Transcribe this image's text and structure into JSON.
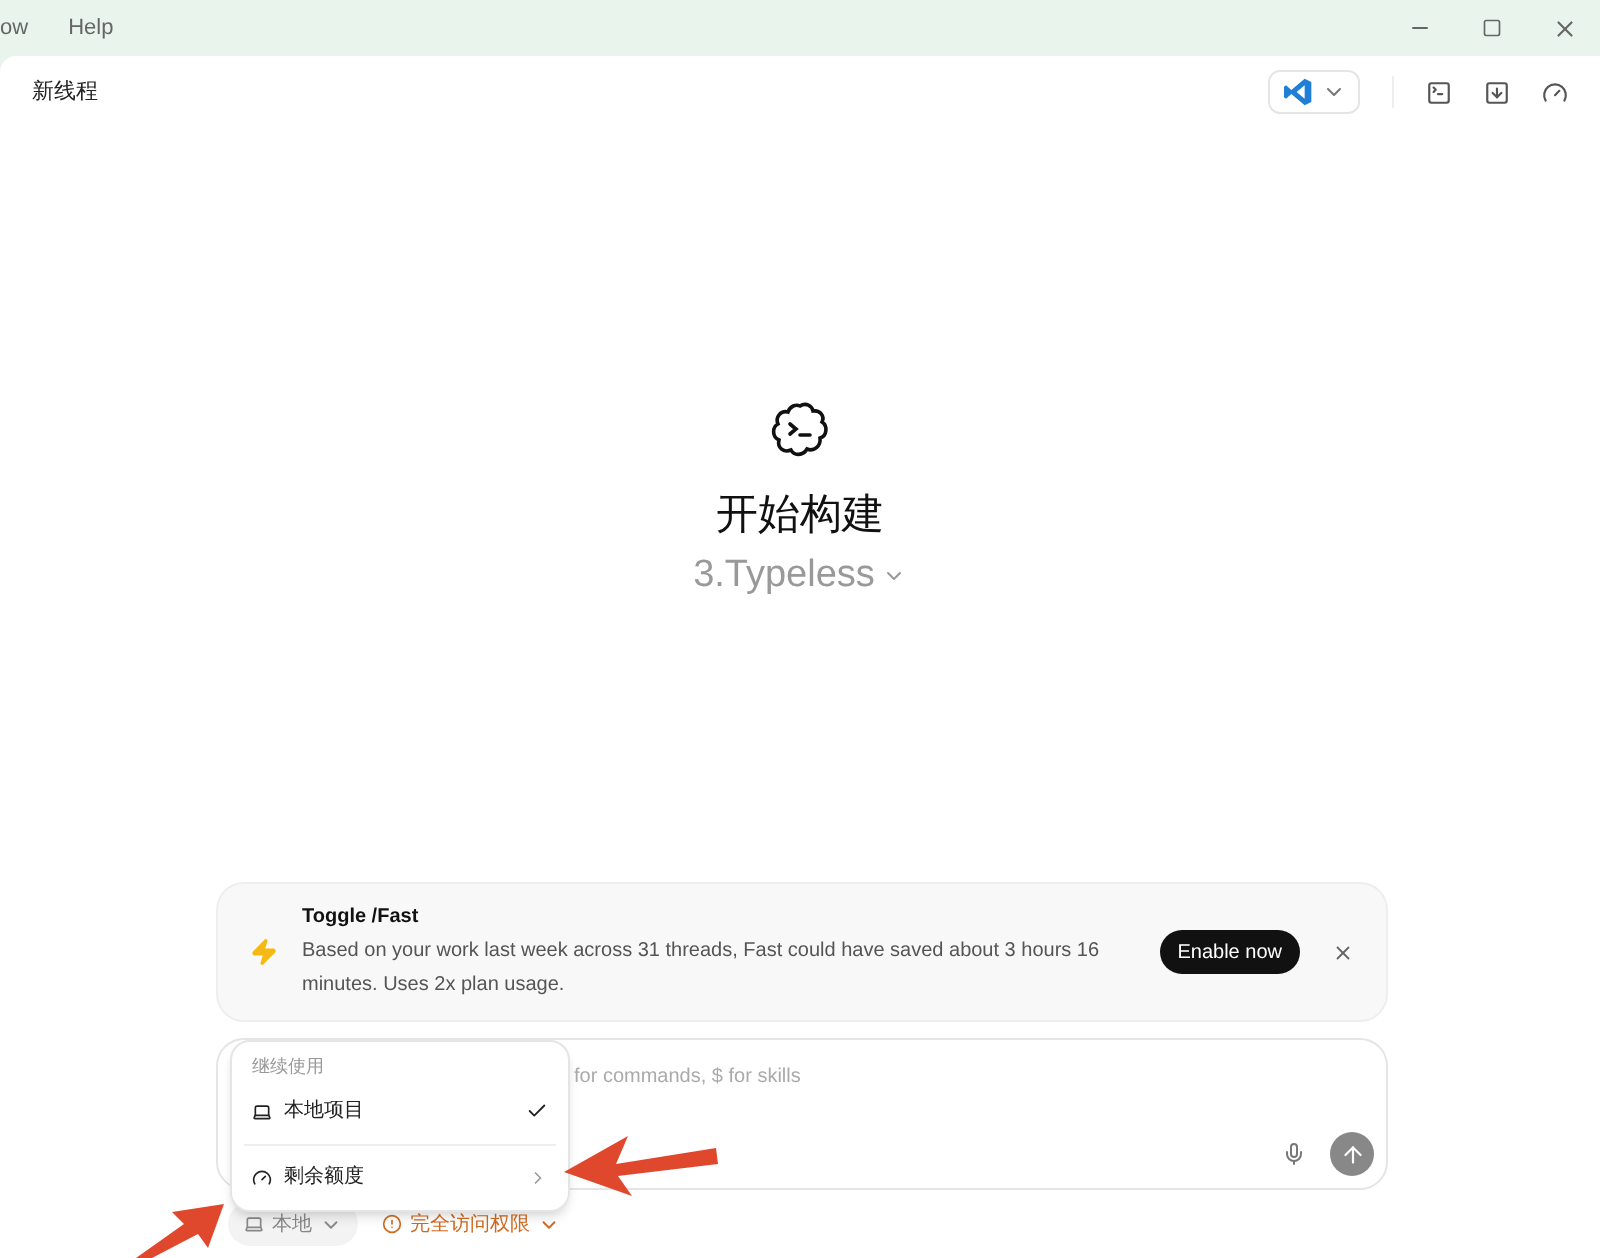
{
  "menu_bar": [
    "ow",
    "Help"
  ],
  "header": {
    "title": "新线程"
  },
  "hero": {
    "title": "开始构建",
    "project": "3.Typeless"
  },
  "banner": {
    "title": "Toggle /Fast",
    "text": "Based on your work last week across 31 threads, Fast could have saved about 3 hours 16 minutes. Uses 2x plan usage.",
    "button": "Enable now"
  },
  "composer": {
    "placeholder": "for commands, $ for skills"
  },
  "dropdown": {
    "heading": "继续使用",
    "items": [
      {
        "label": "本地项目",
        "kind": "option",
        "checked": true
      },
      {
        "label": "剩余额度",
        "kind": "submenu",
        "checked": false
      }
    ]
  },
  "bottom_bar": {
    "location": "本地",
    "access": "完全访问权限"
  }
}
